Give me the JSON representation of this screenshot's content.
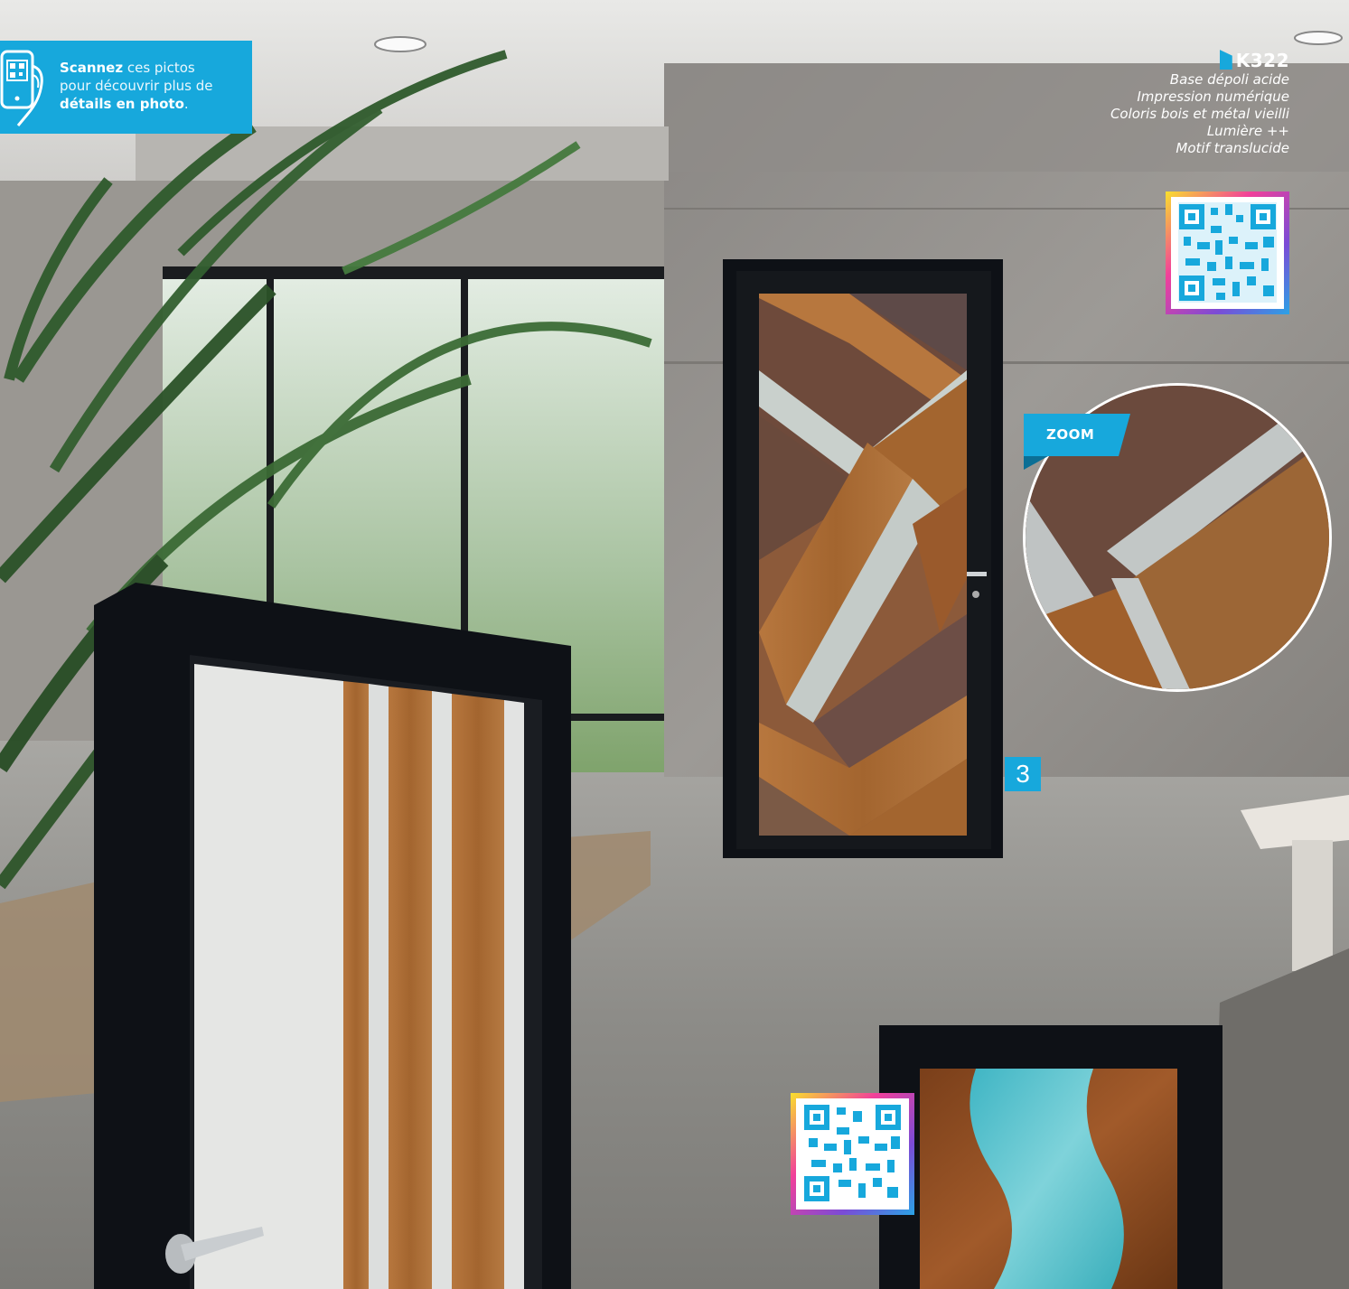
{
  "scan_banner": {
    "line1_bold": "Scannez",
    "line1_rest": " ces pictos",
    "line2": "pour découvrir plus de",
    "line3_bold": "détails en photo",
    "line3_end": "."
  },
  "product": {
    "code": "K322",
    "features": [
      "Base dépoli acide",
      "Impression numérique",
      "Coloris bois et métal vieilli",
      "Lumière ++",
      "Motif translucide"
    ]
  },
  "zoom_label": "ZOOM",
  "step_number": "3",
  "colors": {
    "accent": "#17a8dc",
    "frame": "#0e1116",
    "wood": "#a8652f",
    "rust": "#6e4a3b",
    "glass": "#c9d0cc",
    "resin": "#4ec3cf"
  },
  "icons": [
    "phone-qr-icon",
    "qr-code-icon"
  ]
}
